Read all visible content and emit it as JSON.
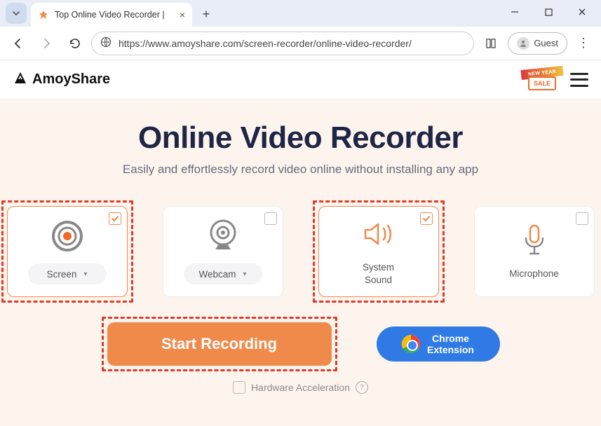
{
  "browser": {
    "tab_title": "Top Online Video Recorder |",
    "url": "https://www.amoyshare.com/screen-recorder/online-video-recorder/",
    "guest_label": "Guest"
  },
  "site": {
    "brand": "AmoyShare",
    "sale_top": "NEW YEAR",
    "sale_body": "SALE"
  },
  "hero": {
    "title": "Online Video Recorder",
    "subtitle": "Easily and effortlessly record video online without installing any app"
  },
  "cards": {
    "screen": {
      "label": "Screen"
    },
    "webcam": {
      "label": "Webcam"
    },
    "system_sound": {
      "label": "System\nSound"
    },
    "microphone": {
      "label": "Microphone"
    }
  },
  "actions": {
    "start": "Start Recording",
    "ext_line1": "Chrome",
    "ext_line2": "Extension",
    "hw_label": "Hardware Acceleration"
  }
}
